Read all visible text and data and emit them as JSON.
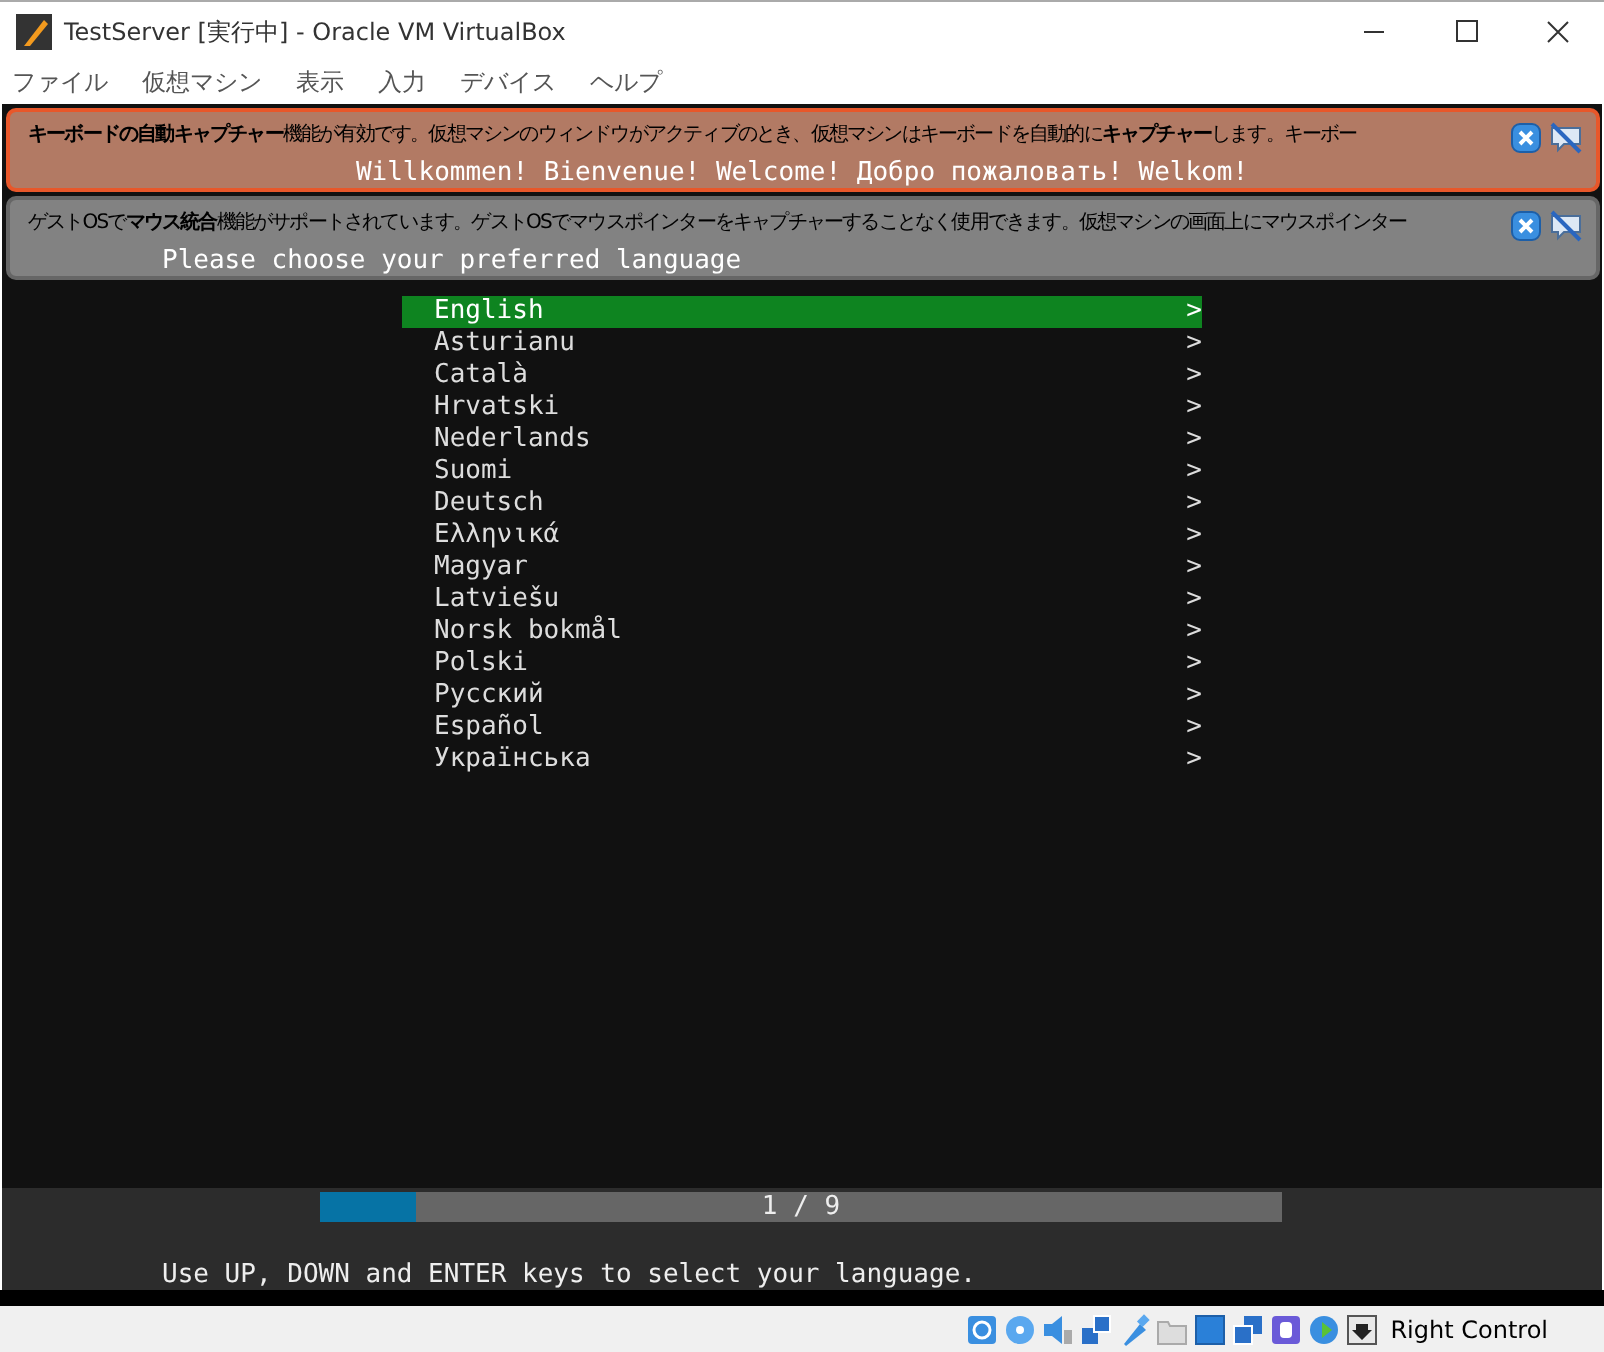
{
  "window": {
    "title": "TestServer [実行中] - Oracle VM VirtualBox"
  },
  "menu": [
    "ファイル",
    "仮想マシン",
    "表示",
    "入力",
    "デバイス",
    "ヘルプ"
  ],
  "notices": [
    {
      "kind": "keyboard",
      "text": "**キーボードの自動キャプチャー**機能が有効です。仮想マシンのウィンドウがアクティブのとき、仮想マシンはキーボードを自動的に**キャプチャー**します。キーボー"
    },
    {
      "kind": "mouse",
      "text": "ゲストOSで**マウス統合**機能がサポートされています。ゲストOSでマウスポインターをキャプチャーすることなく使用できます。仮想マシンの画面上にマウスポインター"
    }
  ],
  "vm_screen": {
    "welcome": "Willkommen! Bienvenue! Welcome! Добро пожаловать! Welkom!",
    "prompt": "Please choose your preferred language",
    "languages": [
      {
        "label": "English",
        "selected": true
      },
      {
        "label": "Asturianu",
        "selected": false
      },
      {
        "label": "Català",
        "selected": false
      },
      {
        "label": "Hrvatski",
        "selected": false
      },
      {
        "label": "Nederlands",
        "selected": false
      },
      {
        "label": "Suomi",
        "selected": false
      },
      {
        "label": "Deutsch",
        "selected": false
      },
      {
        "label": "Ελληνικά",
        "selected": false
      },
      {
        "label": "Magyar",
        "selected": false
      },
      {
        "label": "Latviešu",
        "selected": false
      },
      {
        "label": "Norsk bokmål",
        "selected": false
      },
      {
        "label": "Polski",
        "selected": false
      },
      {
        "label": "Русский",
        "selected": false
      },
      {
        "label": "Español",
        "selected": false
      },
      {
        "label": "Українська",
        "selected": false
      }
    ],
    "arrow": ">",
    "progress": {
      "level": 0.1,
      "reading": "1 / 9"
    },
    "help": "Use UP, DOWN and ENTER keys to select your language."
  },
  "status_bar": {
    "host_key": "Right Control"
  }
}
